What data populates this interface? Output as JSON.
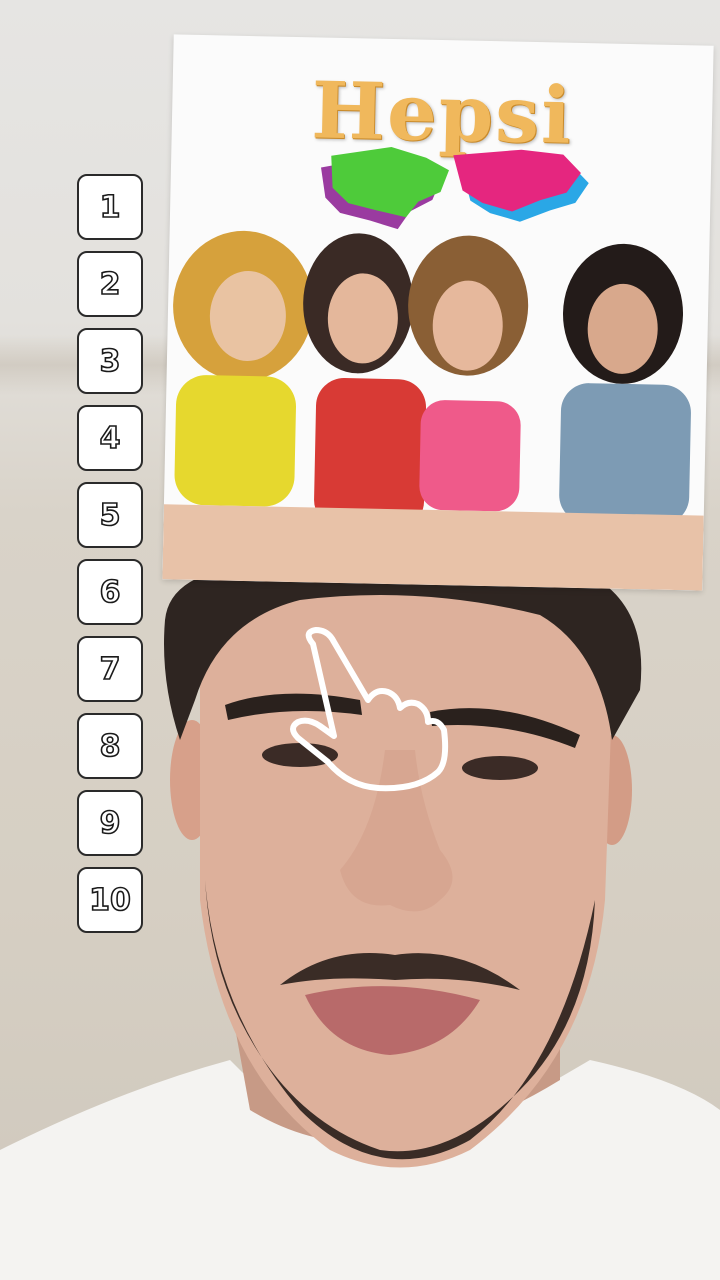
{
  "filter": {
    "album": {
      "title": "Hepsi"
    },
    "ranking_slots": [
      {
        "label": "1"
      },
      {
        "label": "2"
      },
      {
        "label": "3"
      },
      {
        "label": "4"
      },
      {
        "label": "5"
      },
      {
        "label": "6"
      },
      {
        "label": "7"
      },
      {
        "label": "8"
      },
      {
        "label": "9"
      },
      {
        "label": "10"
      }
    ],
    "tap_hint_icon": "pointing-hand-icon"
  },
  "colors": {
    "title": "#f0b85c",
    "slot_border": "#2a2a2a",
    "slot_fill": "#ffffff"
  }
}
